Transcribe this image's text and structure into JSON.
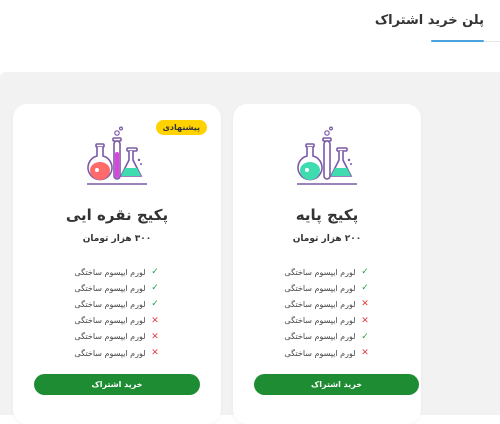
{
  "header": {
    "title": "پلن خرید اشتراک"
  },
  "plans": [
    {
      "name": "پکیج پایه",
      "price": "۲۰۰ هزار تومان",
      "badge": "",
      "button": "خرید اشتراک",
      "features": [
        {
          "label": "لورم ایپسوم ساختگی",
          "included": true
        },
        {
          "label": "لورم ایپسوم ساختگی",
          "included": true
        },
        {
          "label": "لورم ایپسوم ساختگی",
          "included": false
        },
        {
          "label": "لورم ایپسوم ساختگی",
          "included": false
        },
        {
          "label": "لورم ایپسوم ساختگی",
          "included": true
        },
        {
          "label": "لورم ایپسوم ساختگی",
          "included": false
        }
      ]
    },
    {
      "name": "پکیج نقره ایی",
      "price": "۳۰۰ هزار تومان",
      "badge": "پیشنهادی",
      "button": "خرید اشتراک",
      "features": [
        {
          "label": "لورم ایپسوم ساختگی",
          "included": true
        },
        {
          "label": "لورم ایپسوم ساختگی",
          "included": true
        },
        {
          "label": "لورم ایپسوم ساختگی",
          "included": true
        },
        {
          "label": "لورم ایپسوم ساختگی",
          "included": false
        },
        {
          "label": "لورم ایپسوم ساختگی",
          "included": false
        },
        {
          "label": "لورم ایپسوم ساختگی",
          "included": false
        }
      ]
    }
  ],
  "icons": {
    "included": "check-icon",
    "excluded": "cross-icon",
    "illustration": "lab-flasks-icon"
  },
  "colors": {
    "accent": "#4aa3df",
    "button": "#1e8c32",
    "badge": "#ffd200",
    "check": "#27a04a",
    "cross": "#e23b3b"
  }
}
